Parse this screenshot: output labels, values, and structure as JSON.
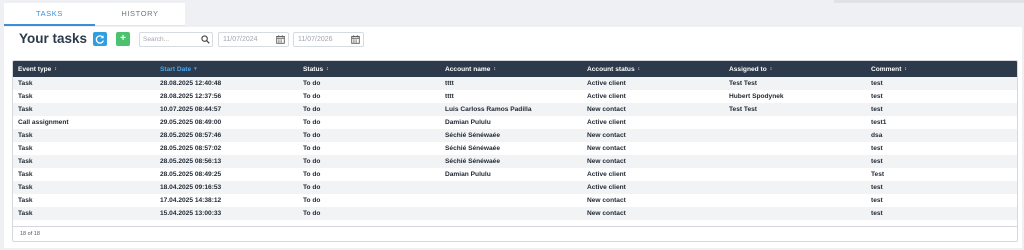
{
  "tabs": [
    {
      "label": "TASKS",
      "active": true
    },
    {
      "label": "HISTORY",
      "active": false
    }
  ],
  "toolbar": {
    "title": "Your tasks",
    "refresh_icon": "refresh-icon",
    "add_label": "+",
    "search_placeholder": "Search...",
    "date_from": "11/07/2024",
    "date_to": "11/07/2026"
  },
  "colors": {
    "accent": "#3b8fd8",
    "header_bg": "#2c3a4b",
    "refresh_button": "#2f9fe0",
    "add_button": "#4bc26d"
  },
  "table": {
    "columns": [
      {
        "label": "Event type",
        "sort": "↕"
      },
      {
        "label": "Start Date",
        "sort": "▾",
        "sorted": true
      },
      {
        "label": "Status",
        "sort": "↕"
      },
      {
        "label": "Account name",
        "sort": "↕"
      },
      {
        "label": "Account status",
        "sort": "↕"
      },
      {
        "label": "Assigned to",
        "sort": "↕"
      },
      {
        "label": "Comment",
        "sort": "↕"
      }
    ],
    "rows": [
      [
        "Task",
        "28.08.2025 12:40:48",
        "To do",
        "tttt",
        "Active client",
        "Test Test",
        "test"
      ],
      [
        "Task",
        "28.08.2025 12:37:56",
        "To do",
        "tttt",
        "Active client",
        "Hubert Spodynek",
        "test"
      ],
      [
        "Task",
        "10.07.2025 08:44:57",
        "To do",
        "Luis Carloss Ramos Padilla",
        "New contact",
        "Test Test",
        "test"
      ],
      [
        "Call assignment",
        "29.05.2025 08:49:00",
        "To do",
        "Damian Pululu",
        "Active client",
        "",
        "test1"
      ],
      [
        "Task",
        "28.05.2025 08:57:46",
        "To do",
        "Séchié Sénéwaée",
        "New contact",
        "",
        "dsa"
      ],
      [
        "Task",
        "28.05.2025 08:57:02",
        "To do",
        "Séchié Sénéwaée",
        "New contact",
        "",
        "test"
      ],
      [
        "Task",
        "28.05.2025 08:56:13",
        "To do",
        "Séchié Sénéwaée",
        "New contact",
        "",
        "test"
      ],
      [
        "Task",
        "28.05.2025 08:49:25",
        "To do",
        "Damian Pululu",
        "Active client",
        "",
        "Test"
      ],
      [
        "Task",
        "18.04.2025 09:16:53",
        "To do",
        "",
        "Active client",
        "",
        "test"
      ],
      [
        "Task",
        "17.04.2025 14:38:12",
        "To do",
        "",
        "New contact",
        "",
        "test"
      ],
      [
        "Task",
        "15.04.2025 13:00:33",
        "To do",
        "",
        "New contact",
        "",
        "test"
      ]
    ]
  },
  "footer": {
    "count_text": "18 of 18"
  }
}
